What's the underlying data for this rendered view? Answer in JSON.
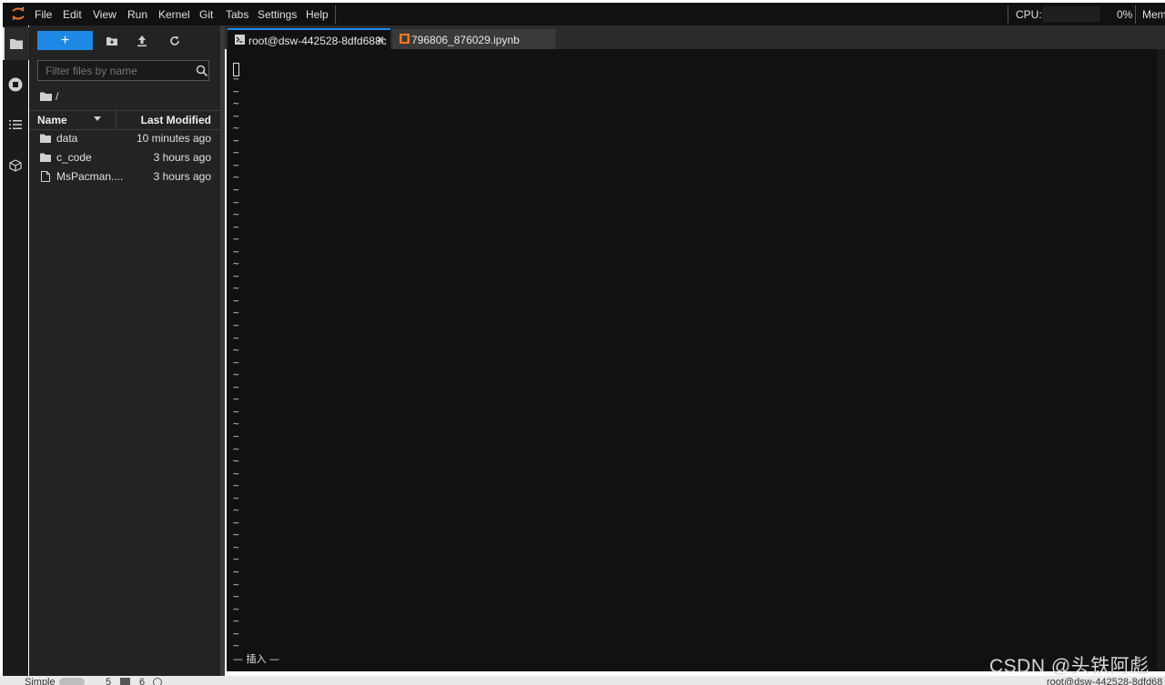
{
  "menubar": {
    "items": [
      "File",
      "Edit",
      "View",
      "Run",
      "Kernel",
      "Git",
      "Tabs",
      "Settings",
      "Help"
    ],
    "cpu_label": "CPU:",
    "cpu_value": "0%",
    "mem_label": "Mem:"
  },
  "filebrowser": {
    "new_label": "+",
    "filter_placeholder": "Filter files by name",
    "breadcrumb": "/",
    "header_name": "Name",
    "header_modified": "Last Modified",
    "files": [
      {
        "name": "data",
        "modified": "10 minutes ago",
        "type": "folder"
      },
      {
        "name": "c_code",
        "modified": "3 hours ago",
        "type": "folder"
      },
      {
        "name": "MsPacman....",
        "modified": "3 hours ago",
        "type": "file"
      }
    ]
  },
  "tabs": [
    {
      "label": "root@dsw-442528-8dfd688c",
      "close": "✕",
      "icon": "terminal-icon"
    },
    {
      "label": "796806_876029.ipynb",
      "icon": "notebook-icon"
    }
  ],
  "terminal": {
    "tilde": "~",
    "mode_line": "— 插入 —"
  },
  "statusbar": {
    "mode": "Simple",
    "count_a": "5",
    "count_b": "6",
    "right_text": "root@dsw-442528-8dfd68"
  },
  "watermark": "CSDN @头铁阿彪",
  "colors": {
    "accent": "#1e88e5",
    "background": "#111111",
    "panel": "#232323"
  }
}
